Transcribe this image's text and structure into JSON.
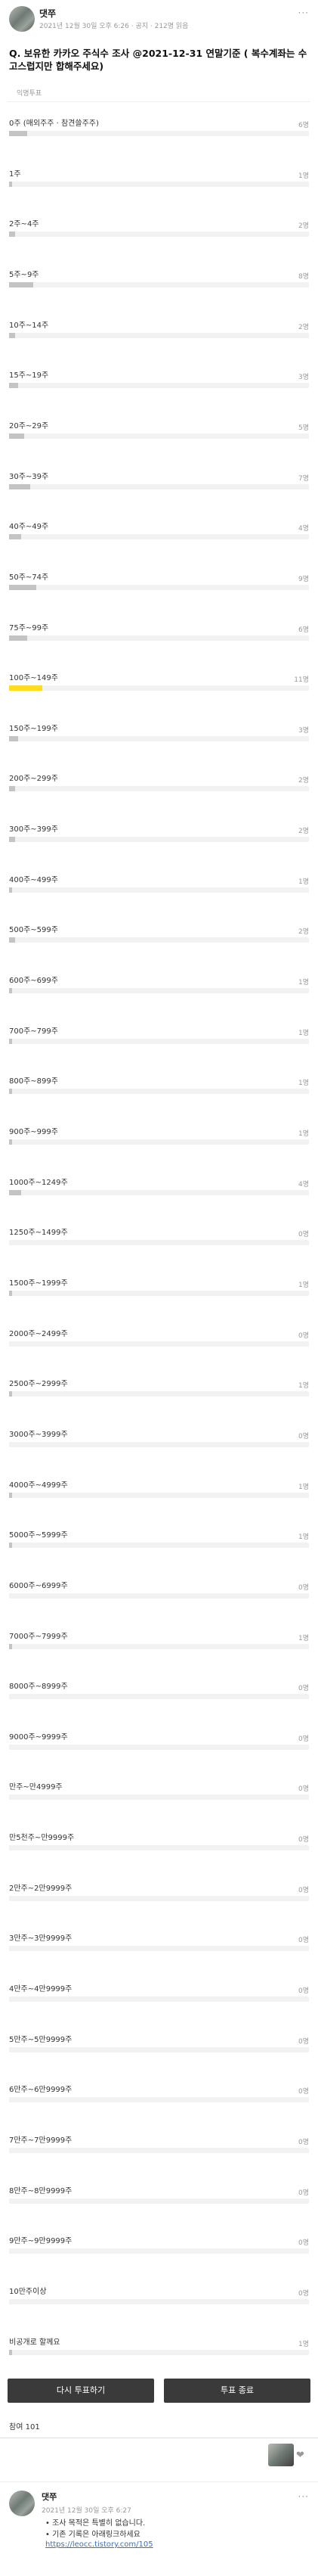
{
  "post": {
    "author": "댓쭈",
    "meta": "2021년 12월 30일 오후 6:26 · 공지 · 212명 읽음",
    "more": "···"
  },
  "poll": {
    "question": "Q. 보유한 카카오 주식수 조사 @2021-12-31 연말기준 ( 복수계좌는 수고스럽지만 합해주세요)",
    "type_label": "익명투표",
    "options": [
      {
        "label": "0주 (매외주주 · 참견쓸주주)",
        "count": "6명",
        "share": 0.06
      },
      {
        "label": "1주",
        "count": "1명",
        "share": 0.01
      },
      {
        "label": "2주~4주",
        "count": "2명",
        "share": 0.02
      },
      {
        "label": "5주~9주",
        "count": "8명",
        "share": 0.08
      },
      {
        "label": "10주~14주",
        "count": "2명",
        "share": 0.02
      },
      {
        "label": "15주~19주",
        "count": "3명",
        "share": 0.03
      },
      {
        "label": "20주~29주",
        "count": "5명",
        "share": 0.05
      },
      {
        "label": "30주~39주",
        "count": "7명",
        "share": 0.07
      },
      {
        "label": "40주~49주",
        "count": "4명",
        "share": 0.04
      },
      {
        "label": "50주~74주",
        "count": "9명",
        "share": 0.09
      },
      {
        "label": "75주~99주",
        "count": "6명",
        "share": 0.06
      },
      {
        "label": "100주~149주",
        "count": "11명",
        "share": 0.11
      },
      {
        "label": "150주~199주",
        "count": "3명",
        "share": 0.03
      },
      {
        "label": "200주~299주",
        "count": "2명",
        "share": 0.02
      },
      {
        "label": "300주~399주",
        "count": "2명",
        "share": 0.02
      },
      {
        "label": "400주~499주",
        "count": "1명",
        "share": 0.01
      },
      {
        "label": "500주~599주",
        "count": "2명",
        "share": 0.02
      },
      {
        "label": "600주~699주",
        "count": "1명",
        "share": 0.01
      },
      {
        "label": "700주~799주",
        "count": "1명",
        "share": 0.01
      },
      {
        "label": "800주~899주",
        "count": "1명",
        "share": 0.01
      },
      {
        "label": "900주~999주",
        "count": "1명",
        "share": 0.01
      },
      {
        "label": "1000주~1249주",
        "count": "4명",
        "share": 0.04
      },
      {
        "label": "1250주~1499주",
        "count": "0명",
        "share": 0
      },
      {
        "label": "1500주~1999주",
        "count": "1명",
        "share": 0.01
      },
      {
        "label": "2000주~2499주",
        "count": "0명",
        "share": 0
      },
      {
        "label": "2500주~2999주",
        "count": "1명",
        "share": 0.01
      },
      {
        "label": "3000주~3999주",
        "count": "0명",
        "share": 0
      },
      {
        "label": "4000주~4999주",
        "count": "1명",
        "share": 0.01
      },
      {
        "label": "5000주~5999주",
        "count": "1명",
        "share": 0.01
      },
      {
        "label": "6000주~6999주",
        "count": "0명",
        "share": 0
      },
      {
        "label": "7000주~7999주",
        "count": "1명",
        "share": 0.01
      },
      {
        "label": "8000주~8999주",
        "count": "0명",
        "share": 0
      },
      {
        "label": "9000주~9999주",
        "count": "0명",
        "share": 0
      },
      {
        "label": "만주~만4999주",
        "count": "0명",
        "share": 0
      },
      {
        "label": "만5천주~만9999주",
        "count": "0명",
        "share": 0
      },
      {
        "label": "2만주~2만9999주",
        "count": "0명",
        "share": 0
      },
      {
        "label": "3만주~3만9999주",
        "count": "0명",
        "share": 0
      },
      {
        "label": "4만주~4만9999주",
        "count": "0명",
        "share": 0
      },
      {
        "label": "5만주~5만9999주",
        "count": "0명",
        "share": 0
      },
      {
        "label": "6만주~6만9999주",
        "count": "0명",
        "share": 0
      },
      {
        "label": "7만주~7만9999주",
        "count": "0명",
        "share": 0
      },
      {
        "label": "8만주~8만9999주",
        "count": "0명",
        "share": 0
      },
      {
        "label": "9만주~9만9999주",
        "count": "0명",
        "share": 0
      },
      {
        "label": "10만주이상",
        "count": "0명",
        "share": 0
      },
      {
        "label": "비공개로 할께요",
        "count": "1명",
        "share": 0.01
      }
    ],
    "top_option_index": 11,
    "highlight_color": "#ffdc1e",
    "bar_color": "#c4c4c4"
  },
  "actions": {
    "revote_label": "다시 투표하기",
    "close_label": "투표 종료"
  },
  "voters": {
    "label": "참여",
    "count": "101"
  },
  "comment": {
    "author": "댓쭈",
    "meta": "2021년 12월 30일 오후 6:27",
    "more": "···",
    "lines": [
      "• 조사 목적은 특별히 없습니다.",
      "• 기존 기록은 아래링크하세요"
    ],
    "link": "https://leocc.tistory.com/105"
  }
}
